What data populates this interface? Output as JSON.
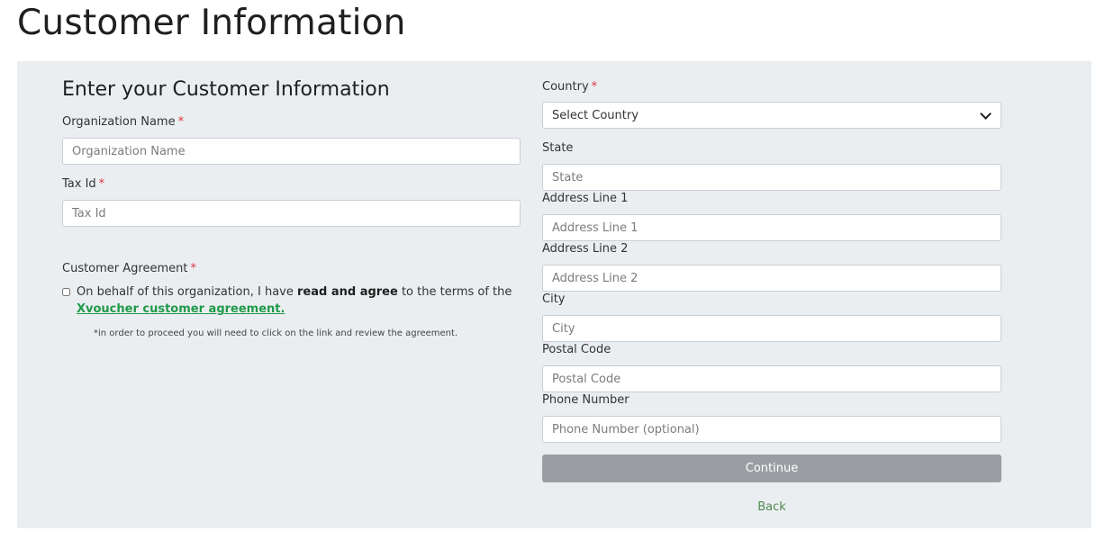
{
  "page": {
    "title": "Customer Information"
  },
  "form": {
    "section_title": "Enter your Customer Information",
    "required_marker": "*",
    "organization_name": {
      "label": "Organization Name",
      "placeholder": "Organization Name",
      "value": ""
    },
    "tax_id": {
      "label": "Tax Id",
      "placeholder": "Tax Id",
      "value": ""
    },
    "customer_agreement": {
      "label": "Customer Agreement",
      "text_before": "On behalf of this organization, I have ",
      "text_bold": "read and agree",
      "text_after": " to the terms of the ",
      "link_text": "Xvoucher customer agreement.",
      "hint": "*in order to proceed you will need to click on the link and review the agreement.",
      "checked": false
    },
    "country": {
      "label": "Country",
      "selected": "Select Country"
    },
    "state": {
      "label": "State",
      "placeholder": "State",
      "value": ""
    },
    "address_line_1": {
      "label": "Address Line 1",
      "placeholder": "Address Line 1",
      "value": ""
    },
    "address_line_2": {
      "label": "Address Line 2",
      "placeholder": "Address Line 2",
      "value": ""
    },
    "city": {
      "label": "City",
      "placeholder": "City",
      "value": ""
    },
    "postal_code": {
      "label": "Postal Code",
      "placeholder": "Postal Code",
      "value": ""
    },
    "phone_number": {
      "label": "Phone Number",
      "placeholder": "Phone Number (optional)",
      "value": ""
    },
    "continue_label": "Continue",
    "back_label": "Back"
  },
  "colors": {
    "panel_background": "#ebeef1",
    "required": "#d9363e",
    "link": "#1f9a4a",
    "back_link": "#4e8a4e",
    "continue_button": "#9a9ea3"
  }
}
